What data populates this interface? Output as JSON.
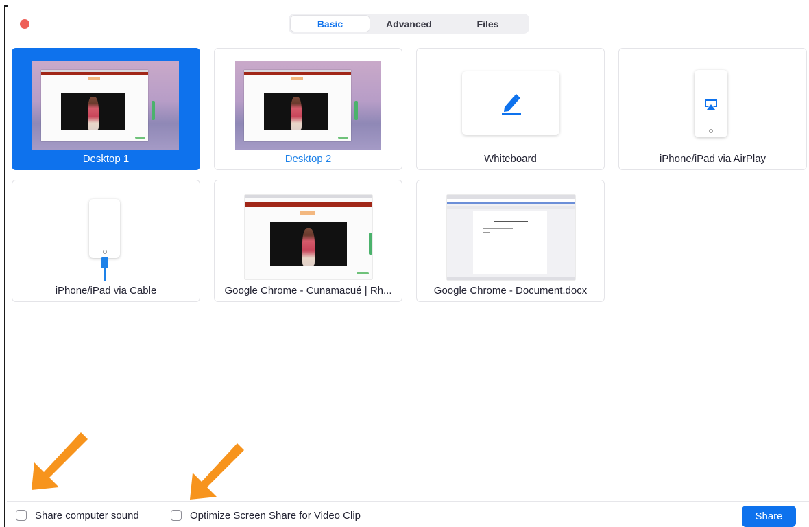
{
  "tabs": [
    {
      "label": "Basic",
      "active": true
    },
    {
      "label": "Advanced",
      "active": false
    },
    {
      "label": "Files",
      "active": false
    }
  ],
  "tiles": [
    {
      "label": "Desktop 1",
      "kind": "desktop",
      "selected": true
    },
    {
      "label": "Desktop 2",
      "kind": "desktop",
      "selected": false
    },
    {
      "label": "Whiteboard",
      "kind": "whiteboard-icon",
      "selected": false
    },
    {
      "label": "iPhone/iPad via AirPlay",
      "kind": "airplay-icon",
      "selected": false
    },
    {
      "label": "iPhone/iPad via Cable",
      "kind": "cable-icon",
      "selected": false
    },
    {
      "label": "Google Chrome - Cunamacué | Rh...",
      "kind": "browser-window",
      "selected": false
    },
    {
      "label": "Google Chrome - Document.docx",
      "kind": "document-window",
      "selected": false
    }
  ],
  "options": {
    "share_sound": {
      "label": "Share computer sound",
      "checked": false
    },
    "optimize_video": {
      "label": "Optimize Screen Share for Video Clip",
      "checked": false
    }
  },
  "share_button": {
    "label": "Share"
  },
  "colors": {
    "accent": "#0e72ed",
    "close": "#ee5f57",
    "annotation_arrow": "#f7941d"
  }
}
